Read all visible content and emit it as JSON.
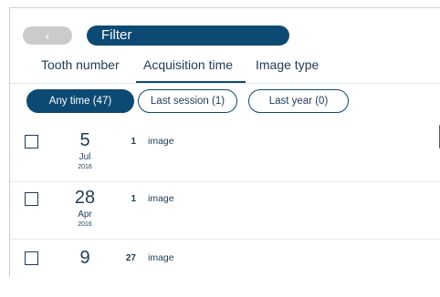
{
  "header": {
    "back_glyph": "‹",
    "title": "Filter"
  },
  "tabs": [
    {
      "label": "Tooth number"
    },
    {
      "label": "Acquisition time"
    },
    {
      "label": "Image type"
    }
  ],
  "chips": [
    {
      "label": "Any time (47)"
    },
    {
      "label": "Last session (1)"
    },
    {
      "label": "Last year (0)"
    }
  ],
  "items": [
    {
      "day": "5",
      "month": "Jul",
      "year": "2016",
      "count": "1",
      "label": "image"
    },
    {
      "day": "28",
      "month": "Apr",
      "year": "2016",
      "count": "1",
      "label": "image"
    },
    {
      "day": "9",
      "month": "",
      "year": "",
      "count": "27",
      "label": "image"
    }
  ],
  "colors": {
    "accent": "#0d4a73",
    "text": "#1f3a56"
  }
}
